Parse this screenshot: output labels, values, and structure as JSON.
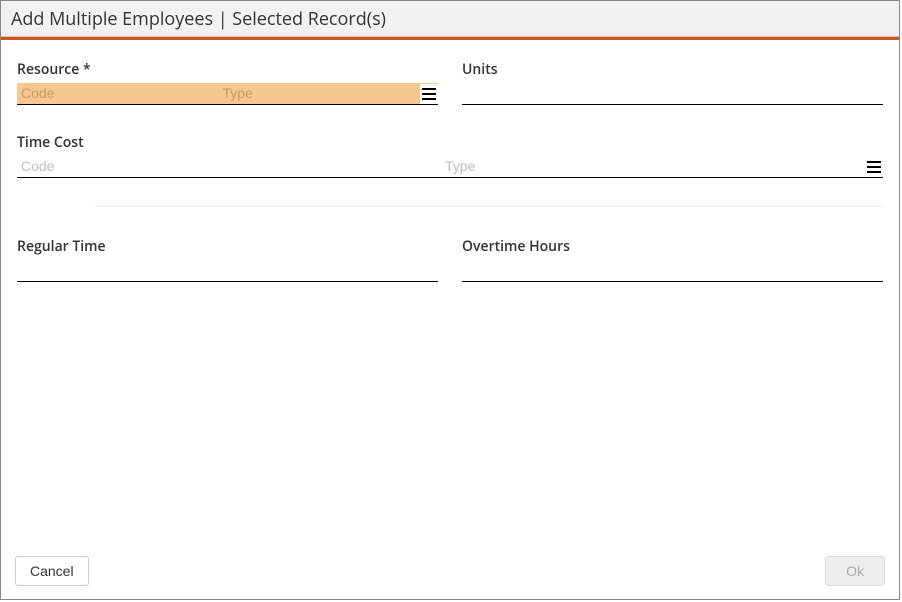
{
  "window": {
    "title": "Add Multiple Employees | Selected Record(s)"
  },
  "fields": {
    "resource": {
      "label": "Resource *",
      "code_placeholder": "Code",
      "type_placeholder": "Type",
      "code_value": "",
      "type_value": ""
    },
    "units": {
      "label": "Units",
      "value": ""
    },
    "time_cost": {
      "label": "Time Cost",
      "code_placeholder": "Code",
      "type_placeholder": "Type",
      "code_value": "",
      "type_value": ""
    },
    "regular_time": {
      "label": "Regular Time",
      "value": ""
    },
    "overtime_hours": {
      "label": "Overtime Hours",
      "value": ""
    }
  },
  "footer": {
    "cancel_label": "Cancel",
    "ok_label": "Ok"
  }
}
